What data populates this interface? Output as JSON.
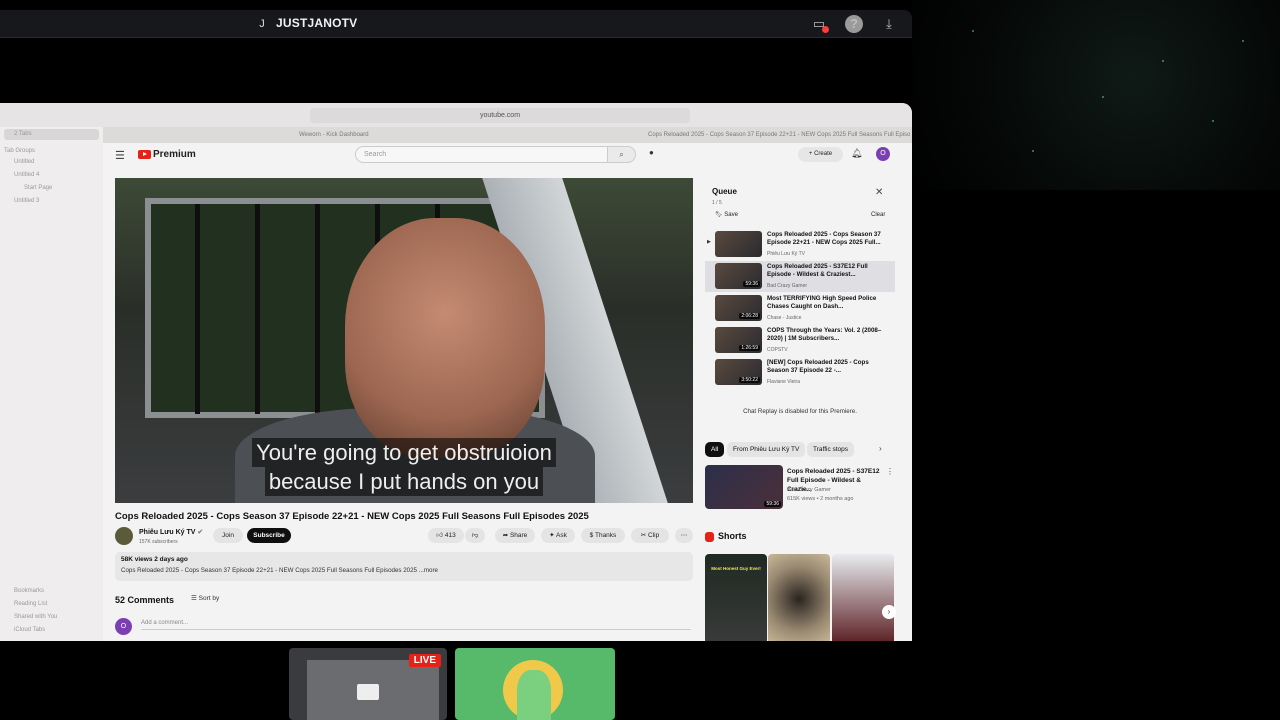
{
  "stream_app": {
    "avatar_letter": "J",
    "channel_name": "JUSTJANOTV",
    "help_glyph": "?"
  },
  "safari": {
    "url": "youtube.com",
    "sidebar": {
      "tabs_label": "2 Tabs",
      "groups_label": "Tab Groups",
      "items": [
        "Untitled",
        "Untitled 4",
        "Start Page",
        "Untitled 3"
      ],
      "bottom": [
        "Bookmarks",
        "Reading List",
        "Shared with You",
        "iCloud Tabs"
      ]
    },
    "tabs": [
      "Weworn - Kick Dashboard",
      "Cops Reloaded 2025 - Cops Season 37 Episode 22+21 - NEW Cops 2025 Full Seasons Full Episodes 2025"
    ]
  },
  "youtube": {
    "logo": "Premium",
    "search_placeholder": "Search",
    "create_label": "Create",
    "avatar_letter": "O",
    "captions": [
      "You're going to get obstruioion",
      "because I put hands on you"
    ],
    "video_title": "Cops Reloaded 2025 - Cops Season 37 Episode 22+21 - NEW Cops 2025 Full Seasons Full Episodes 2025",
    "channel": {
      "name": "Phiêu Lưu Ký TV",
      "verified": "✔",
      "subscribers": "157K subscribers",
      "join": "Join",
      "subscribe": "Subscribe"
    },
    "actions": {
      "likes": "413",
      "share": "Share",
      "ask": "Ask",
      "thanks": "Thanks",
      "clip": "Clip"
    },
    "description": {
      "views_date": "58K views  2 days ago",
      "text": "Cops Reloaded 2025 - Cops Season 37 Episode 22+21 - NEW Cops 2025 Full Seasons Full Episodes 2025",
      "more": "...more"
    },
    "comments": {
      "count": "52 Comments",
      "sort_by": "Sort by",
      "placeholder": "Add a comment...",
      "avatar_letter": "O"
    },
    "queue": {
      "title": "Queue",
      "position": "1 / 5",
      "save": "Save",
      "clear": "Clear",
      "items": [
        {
          "title": "Cops Reloaded 2025 - Cops Season 37 Episode 22+21 - NEW Cops 2025 Full...",
          "channel": "Phiêu Lưu Ký TV",
          "duration": ""
        },
        {
          "title": "Cops Reloaded 2025 - S37E12 Full Episode - Wildest & Craziest...",
          "channel": "Bad Crazy Gamer",
          "duration": "59:36"
        },
        {
          "title": "Most TERRIFYING High Speed Police Chases Caught on Dash...",
          "channel": "Chase - Justice",
          "duration": "2:06:28"
        },
        {
          "title": "COPS Through the Years: Vol. 2 (2008–2020) | 1M Subscribers...",
          "channel": "COPSTV",
          "duration": "1:26:59"
        },
        {
          "title": "[NEW] Cops Reloaded 2025 - Cops Season 37 Episode 22 -...",
          "channel": "Flaviane Vieira",
          "duration": "3:50:22"
        }
      ]
    },
    "chat_replay": "Chat Replay is disabled for this Premiere.",
    "chips": [
      "All",
      "From Phiêu Lưu Ký TV",
      "Traffic stops"
    ],
    "recommended": {
      "title": "Cops Reloaded 2025 - S37E12 Full Episode - Wildest & Crazie...",
      "channel": "Bad Crazy Gamer",
      "meta": "615K views • 2 months ago",
      "duration": "59:36"
    },
    "shorts_title": "Shorts",
    "short_caption": "Most Honest Guy Ever!"
  },
  "tiles": {
    "live_badge": "LIVE"
  }
}
